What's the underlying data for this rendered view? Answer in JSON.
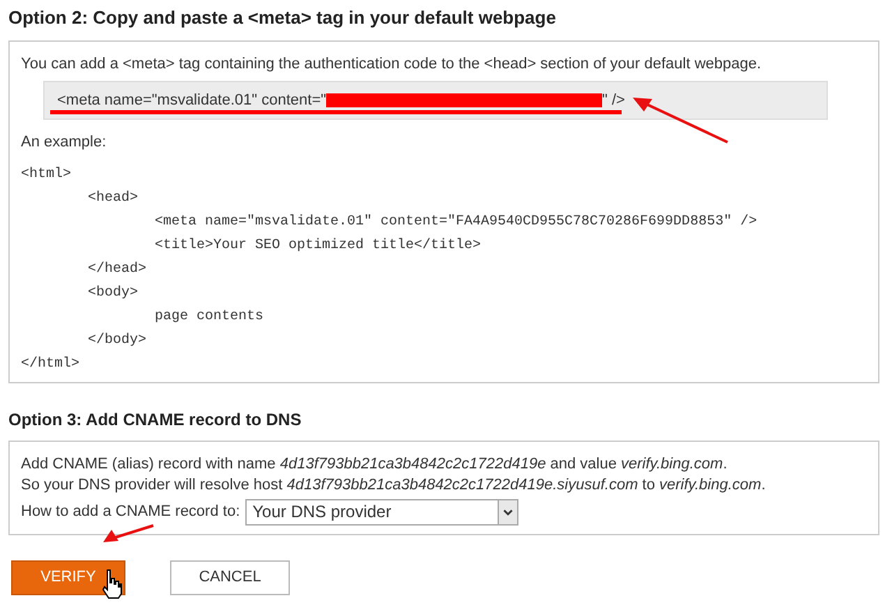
{
  "option2": {
    "heading": "Option 2: Copy and paste a <meta> tag in your default webpage",
    "intro": "You can add a <meta> tag containing the authentication code to the <head> section of your default webpage.",
    "meta_tag": {
      "prefix": "<meta name=\"msvalidate.01\" content=\"",
      "suffix": "\" />",
      "redacted": true
    },
    "example_label": "An example:",
    "example_code": {
      "open": "<html>",
      "close": "</html>",
      "children": [
        {
          "open": "<head>",
          "close": "</head>",
          "children": [
            {
              "text": "<meta name=\"msvalidate.01\" content=\"FA4A9540CD955C78C70286F699DD8853\" />"
            },
            {
              "text": "<title>Your SEO optimized title</title>"
            }
          ]
        },
        {
          "open": "<body>",
          "close": "</body>",
          "children": [
            {
              "text": "page contents"
            }
          ]
        }
      ]
    }
  },
  "option3": {
    "heading": "Option 3: Add CNAME record to DNS",
    "lines": [
      "Add CNAME (alias) record with name *4d13f793bb21ca3b4842c2c1722d419e* and value *verify.bing.com*.",
      "So your DNS provider will resolve host *4d13f793bb21ca3b4842c2c1722d419e.siyusuf.com* to *verify.bing.com*."
    ],
    "select_label": "How to add a CNAME record to:",
    "select_value": "Your DNS provider"
  },
  "buttons": [
    {
      "label": "VERIFY",
      "kind": "primary"
    },
    {
      "label": "CANCEL",
      "kind": "secondary"
    }
  ]
}
